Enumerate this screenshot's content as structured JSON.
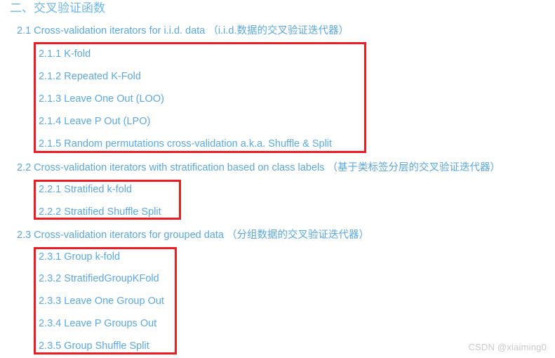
{
  "document": {
    "title": "二、交叉验证函数",
    "title_color": "#6cb7e8",
    "link_color": "#5aa9e2",
    "box_border_color": "#ee1c22",
    "background_color": "#ffffff"
  },
  "sections": [
    {
      "heading": "2.1 Cross-validation iterators for i.i.d. data （i.i.d.数据的交叉验证迭代器）",
      "items": [
        {
          "label": "2.1.1 K-fold"
        },
        {
          "label": "2.1.2 Repeated K-Fold"
        },
        {
          "label": "2.1.3 Leave One Out (LOO)"
        },
        {
          "label": "2.1.4 Leave P Out (LPO)"
        },
        {
          "label": "2.1.5 Random permutations cross-validation a.k.a. Shuffle & Split"
        }
      ]
    },
    {
      "heading": "2.2 Cross-validation iterators with stratification based on class labels （基于类标签分层的交叉验证迭代器）",
      "items": [
        {
          "label": "2.2.1 Stratified k-fold"
        },
        {
          "label": "2.2.2 Stratified Shuffle Split"
        }
      ]
    },
    {
      "heading": "2.3 Cross-validation iterators for grouped data （分组数据的交叉验证迭代器）",
      "items": [
        {
          "label": "2.3.1 Group k-fold"
        },
        {
          "label": "2.3.2 StratifiedGroupKFold"
        },
        {
          "label": "2.3.3 Leave One Group Out"
        },
        {
          "label": "2.3.4 Leave P Groups Out"
        },
        {
          "label": "2.3.5 Group Shuffle Split"
        }
      ]
    }
  ],
  "watermark": {
    "text": "CSDN @xiaiming0"
  }
}
